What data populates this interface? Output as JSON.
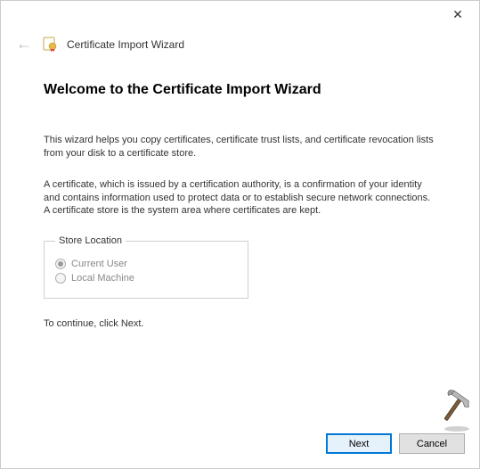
{
  "window": {
    "title": "Certificate Import Wizard"
  },
  "content": {
    "heading": "Welcome to the Certificate Import Wizard",
    "intro": "This wizard helps you copy certificates, certificate trust lists, and certificate revocation lists from your disk to a certificate store.",
    "explanation": "A certificate, which is issued by a certification authority, is a confirmation of your identity and contains information used to protect data or to establish secure network connections. A certificate store is the system area where certificates are kept.",
    "store_location": {
      "legend": "Store Location",
      "options": [
        {
          "label": "Current User",
          "selected": true
        },
        {
          "label": "Local Machine",
          "selected": false
        }
      ]
    },
    "continue_hint": "To continue, click Next."
  },
  "footer": {
    "next": "Next",
    "cancel": "Cancel"
  }
}
